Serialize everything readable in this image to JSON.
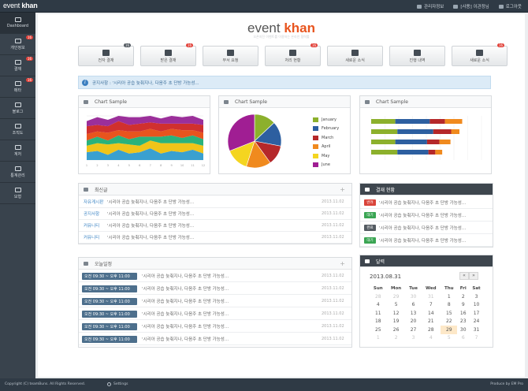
{
  "app": {
    "logo_light": "event ",
    "logo_bold": "khan"
  },
  "topbar": {
    "links": [
      "관리자정보",
      "[사용] 이관정님",
      "로그아웃"
    ]
  },
  "sidebar": {
    "items": [
      {
        "label": "Dashboard",
        "badge": ""
      },
      {
        "label": "개인정보",
        "badge": "16"
      },
      {
        "label": "결재",
        "badge": "16"
      },
      {
        "label": "메타",
        "badge": "16"
      },
      {
        "label": "블로그",
        "badge": ""
      },
      {
        "label": "조직도",
        "badge": ""
      },
      {
        "label": "계처",
        "badge": ""
      },
      {
        "label": "통계관리",
        "badge": ""
      },
      {
        "label": "모형",
        "badge": ""
      }
    ]
  },
  "brand": {
    "light": "event ",
    "bold": "khan",
    "subtitle": "오픈지진 이벤트를 이용하는 온라인 협력툴"
  },
  "quick": [
    {
      "label": "전자 결재",
      "badge": "16",
      "badge_dark": true
    },
    {
      "label": "받은 결재",
      "badge": "16",
      "badge_dark": false
    },
    {
      "label": "부서 요청",
      "badge": "",
      "badge_dark": false
    },
    {
      "label": "처리 현황",
      "badge": "16",
      "badge_dark": false
    },
    {
      "label": "새로운 소식",
      "badge": "",
      "badge_dark": false
    },
    {
      "label": "진행 내역",
      "badge": "",
      "badge_dark": false
    },
    {
      "label": "새로운 소식",
      "badge": "16",
      "badge_dark": false
    }
  ],
  "notice": {
    "label": "공지사항 : '시리아 공습 늦춰지나, 다음주 초 단방 가능성..."
  },
  "charts": {
    "area_title": "Chart Sample",
    "pie_title": "Chart Sample",
    "bar_title": "Chart Sample"
  },
  "chart_data": [
    {
      "type": "area",
      "title": "Chart Sample",
      "x": [
        "1",
        "2",
        "3",
        "4",
        "5",
        "6",
        "7",
        "8",
        "9",
        "10",
        "11",
        "12"
      ],
      "series": [
        {
          "values": [
            6,
            7,
            4,
            8,
            5,
            6,
            9,
            5,
            7,
            6,
            8,
            5
          ],
          "color": "#3aa0d0"
        },
        {
          "values": [
            5,
            6,
            8,
            5,
            7,
            5,
            6,
            8,
            6,
            7,
            5,
            6
          ],
          "color": "#f0c419"
        },
        {
          "values": [
            4,
            5,
            3,
            6,
            4,
            7,
            3,
            5,
            6,
            4,
            6,
            5
          ],
          "color": "#2ab27b"
        },
        {
          "values": [
            5,
            4,
            6,
            4,
            6,
            4,
            6,
            4,
            5,
            6,
            4,
            5
          ],
          "color": "#e8541e"
        },
        {
          "values": [
            6,
            5,
            5,
            7,
            5,
            6,
            5,
            6,
            4,
            5,
            5,
            6
          ],
          "color": "#d0302e"
        },
        {
          "values": [
            4,
            6,
            5,
            4,
            6,
            5,
            5,
            4,
            6,
            5,
            6,
            4
          ],
          "color": "#9b2f9a"
        }
      ]
    },
    {
      "type": "pie",
      "title": "Chart Sample",
      "labels": [
        "January",
        "February",
        "March",
        "April",
        "May",
        "June"
      ],
      "values": [
        13,
        15,
        12,
        15,
        14,
        31
      ],
      "colors": [
        "#8cb02c",
        "#2d5fa0",
        "#b5282a",
        "#f08a1e",
        "#f4d520",
        "#a01e93"
      ]
    },
    {
      "type": "bar",
      "title": "Chart Sample",
      "categories": [
        "1",
        "2",
        "3",
        "4"
      ],
      "series": [
        {
          "values": [
            35,
            38,
            35,
            38
          ],
          "color": "#8cb02c"
        },
        {
          "values": [
            50,
            52,
            46,
            45
          ],
          "color": "#2d5fa0"
        },
        {
          "values": [
            22,
            26,
            18,
            10
          ],
          "color": "#b5282a"
        },
        {
          "values": [
            25,
            12,
            16,
            10
          ],
          "color": "#f08a1e"
        }
      ]
    }
  ],
  "recent": {
    "title": "최신글",
    "rows": [
      {
        "cat": "자유게시판",
        "text": "'시리아 공습 늦춰지나, 다음주 초 단방 가능성...",
        "date": "2013.11.02"
      },
      {
        "cat": "공지사항",
        "text": "'시리아 공습 늦춰지나, 다음주 초 단방 가능성...",
        "date": "2013.11.02"
      },
      {
        "cat": "커뮤니티",
        "text": "'시리아 공습 늦춰지나, 다음주 초 단방 가능성...",
        "date": "2013.11.02"
      },
      {
        "cat": "커뮤니티",
        "text": "'시리아 공습 늦춰지나, 다음주 초 단방 가능성...",
        "date": "2013.11.02"
      }
    ]
  },
  "schedule": {
    "title": "오늘일정",
    "rows": [
      {
        "time": "오전 09:30 ~ 오후 11:00",
        "text": "'시리아 공습 늦춰지나, 다음주 초 단방 가능성...",
        "date": "2013.11.02"
      },
      {
        "time": "오전 09:30 ~ 오후 11:00",
        "text": "'시리아 공습 늦춰지나, 다음주 초 단방 가능성...",
        "date": "2013.11.02"
      },
      {
        "time": "오전 09:30 ~ 오후 11:00",
        "text": "'시리아 공습 늦춰지나, 다음주 초 단방 가능성...",
        "date": "2013.11.02"
      },
      {
        "time": "오전 09:30 ~ 오후 11:00",
        "text": "'시리아 공습 늦춰지나, 다음주 초 단방 가능성...",
        "date": "2013.11.02"
      },
      {
        "time": "오전 09:30 ~ 오후 11:00",
        "text": "'시리아 공습 늦춰지나, 다음주 초 단방 가능성...",
        "date": "2013.11.02"
      },
      {
        "time": "오전 09:30 ~ 오후 11:00",
        "text": "'시리아 공습 늦춰지나, 다음주 초 단방 가능성...",
        "date": "2013.11.02"
      }
    ]
  },
  "payment": {
    "title": "결재 현황",
    "rows": [
      {
        "badge": "반려",
        "color": "#d9443a",
        "text": "'시리아 공습 늦춰지나, 다음주 초 단방 가능성..."
      },
      {
        "badge": "대기",
        "color": "#3aa553",
        "text": "'시리아 공습 늦춰지나, 다음주 초 단방 가능성..."
      },
      {
        "badge": "완료",
        "color": "#545b62",
        "text": "'시리아 공습 늦춰지나, 다음주 초 단방 가능성..."
      },
      {
        "badge": "대기",
        "color": "#3aa553",
        "text": "'시리아 공습 늦춰지나, 다음주 초 단방 가능성..."
      }
    ]
  },
  "calendar": {
    "title": "달력",
    "month": "2013.08.31",
    "prev": "«",
    "next": "»",
    "days": [
      "Sun",
      "Mon",
      "Tue",
      "Wed",
      "Thu",
      "Fri",
      "Sat"
    ],
    "weeks": [
      [
        "28",
        "29",
        "30",
        "31",
        "1",
        "2",
        "3"
      ],
      [
        "4",
        "5",
        "6",
        "7",
        "8",
        "9",
        "10"
      ],
      [
        "11",
        "12",
        "13",
        "14",
        "15",
        "16",
        "17"
      ],
      [
        "18",
        "19",
        "20",
        "21",
        "22",
        "23",
        "24"
      ],
      [
        "25",
        "26",
        "27",
        "28",
        "29",
        "30",
        "31"
      ],
      [
        "1",
        "2",
        "3",
        "4",
        "5",
        "6",
        "7"
      ]
    ]
  },
  "footer": {
    "copyright": "Copyright (C) teamBuns. All Rights Reserved.",
    "settings": "Settings",
    "producer": "Produce by EM Pro"
  }
}
